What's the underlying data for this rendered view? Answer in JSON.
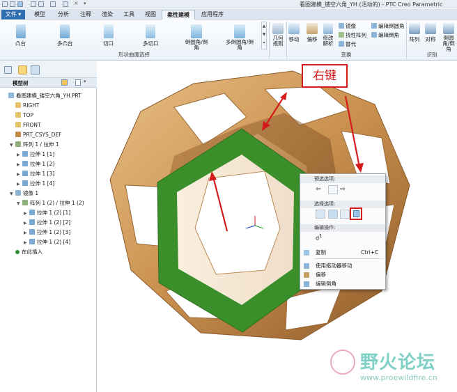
{
  "window": {
    "title": "看图建模_镂空六角_YH (活动的) - PTC Creo Parametric"
  },
  "tabs": [
    {
      "label": "文件 ▾",
      "active": false
    },
    {
      "label": "模型",
      "active": false
    },
    {
      "label": "分析",
      "active": false
    },
    {
      "label": "注释",
      "active": false
    },
    {
      "label": "渲染",
      "active": false
    },
    {
      "label": "工具",
      "active": false
    },
    {
      "label": "视图",
      "active": false
    },
    {
      "label": "柔性建模",
      "active": true
    },
    {
      "label": "应用程序",
      "active": false
    }
  ],
  "ribbon": {
    "shape_buttons": [
      "凸台",
      "多凸台",
      "切口",
      "多切口",
      "倒圆角/倒角",
      "多倒圆角/倒角"
    ],
    "shape_group": "形状曲面选择",
    "transform_buttons": [
      "几何规则",
      "移动",
      "偏移",
      "修改解析"
    ],
    "transform_small": [
      "镜像",
      "挠性阵列",
      "替代",
      "编辑倒圆角",
      "编辑倒角"
    ],
    "transform_group": "变换",
    "recognize_buttons": [
      "阵列",
      "对称",
      "倒圆角/倒角"
    ],
    "recognize_group": "识别"
  },
  "tree": {
    "header": "模型树",
    "items": [
      {
        "label": "看图建模_镂空六角_YH.PRT",
        "level": 0,
        "icon": "part-icon",
        "expander": ""
      },
      {
        "label": "RIGHT",
        "level": 1,
        "icon": "datum-plane-icon",
        "expander": ""
      },
      {
        "label": "TOP",
        "level": 1,
        "icon": "datum-plane-icon",
        "expander": ""
      },
      {
        "label": "FRONT",
        "level": 1,
        "icon": "datum-plane-icon",
        "expander": ""
      },
      {
        "label": "PRT_CSYS_DEF",
        "level": 1,
        "icon": "csys-icon",
        "expander": ""
      },
      {
        "label": "阵列 1 / 拉伸 1",
        "level": 1,
        "icon": "pattern-icon",
        "expander": "▼"
      },
      {
        "label": "拉伸 1 [1]",
        "level": 2,
        "icon": "extrude-icon",
        "expander": "▶"
      },
      {
        "label": "拉伸 1 [2]",
        "level": 2,
        "icon": "extrude-icon",
        "expander": "▶"
      },
      {
        "label": "拉伸 1 [3]",
        "level": 2,
        "icon": "extrude-icon",
        "expander": "▶"
      },
      {
        "label": "拉伸 1 [4]",
        "level": 2,
        "icon": "extrude-icon",
        "expander": "▶"
      },
      {
        "label": "镜像 1",
        "level": 1,
        "icon": "mirror-icon",
        "expander": "▼"
      },
      {
        "label": "阵列 1 (2) / 拉伸 1 (2)",
        "level": 2,
        "icon": "pattern-icon",
        "expander": "▼"
      },
      {
        "label": "拉伸 1 (2) [1]",
        "level": 3,
        "icon": "extrude-icon",
        "expander": "▶"
      },
      {
        "label": "拉伸 1 (2) [2]",
        "level": 3,
        "icon": "extrude-icon",
        "expander": "▶"
      },
      {
        "label": "拉伸 1 (2) [3]",
        "level": 3,
        "icon": "extrude-icon",
        "expander": "▶"
      },
      {
        "label": "拉伸 1 (2) [4]",
        "level": 3,
        "icon": "extrude-icon",
        "expander": "▶"
      },
      {
        "label": "在此插入",
        "level": 1,
        "icon": "insert-here-icon",
        "expander": ""
      }
    ]
  },
  "context_menu": {
    "preselect_header": "预选选项:",
    "select_header": "选择选项:",
    "edit_header": "编辑操作:",
    "items": [
      {
        "label": "复制",
        "shortcut": "Ctrl+C",
        "icon": "copy-icon"
      },
      {
        "label": "使用拖动器移动",
        "shortcut": "",
        "icon": "move-dragger-icon"
      },
      {
        "label": "偏移",
        "shortcut": "",
        "icon": "offset-icon"
      },
      {
        "label": "编辑倒角",
        "shortcut": "",
        "icon": "edit-chamfer-icon"
      }
    ]
  },
  "annotation": {
    "callout": "右键",
    "color": "#d41c1c"
  },
  "watermark": {
    "brand": "野火论坛",
    "url": "www.proewildfire.cn"
  },
  "colors": {
    "wood": "#c98f4e",
    "selected_face": "#3a8f2a",
    "accent": "#d41c1c"
  }
}
